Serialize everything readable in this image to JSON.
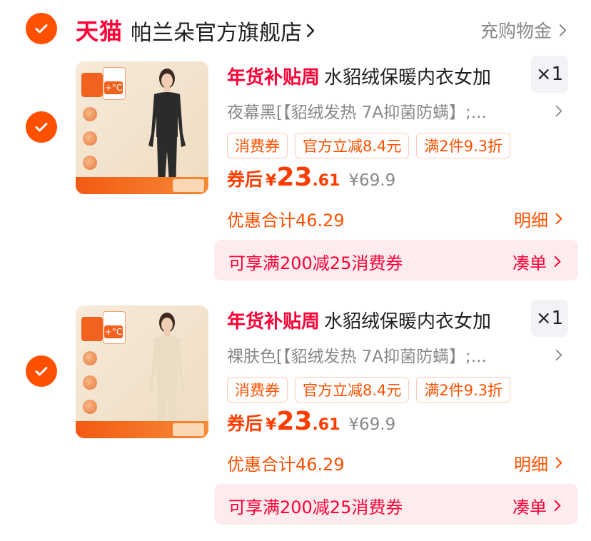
{
  "store": {
    "brand": "天猫",
    "name": "帕兰朵官方旗舰店",
    "rebate_label": "充购物金"
  },
  "items": [
    {
      "promo_label": "年货补贴周",
      "title": "水貂绒保暖内衣女加",
      "quantity": "×1",
      "sku": "夜幕黑[【貂绒发热 7A抑菌防螨】;...",
      "tags": [
        "消费券",
        "官方立减8.4元",
        "满2件9.3折"
      ],
      "price_prefix": "券后",
      "currency": "¥",
      "price_int": "23",
      "price_dec": ".61",
      "original_price": "¥69.9",
      "discount_total": "优惠合计46.29",
      "detail_label": "明细",
      "coupon_text": "可享满200减25消费券",
      "coupon_action": "凑单",
      "garment_color": "#2b2b2b"
    },
    {
      "promo_label": "年货补贴周",
      "title": "水貂绒保暖内衣女加",
      "quantity": "×1",
      "sku": "裸肤色[【貂绒发热 7A抑菌防螨】;...",
      "tags": [
        "消费券",
        "官方立减8.4元",
        "满2件9.3折"
      ],
      "price_prefix": "券后",
      "currency": "¥",
      "price_int": "23",
      "price_dec": ".61",
      "original_price": "¥69.9",
      "discount_total": "优惠合计46.29",
      "detail_label": "明细",
      "coupon_text": "可享满200减25消费券",
      "coupon_action": "凑单",
      "garment_color": "#e9dcc4"
    }
  ],
  "colors": {
    "accent_orange": "#ff5000",
    "tmall_red": "#ff0036",
    "coupon_bg": "#fdecee"
  }
}
